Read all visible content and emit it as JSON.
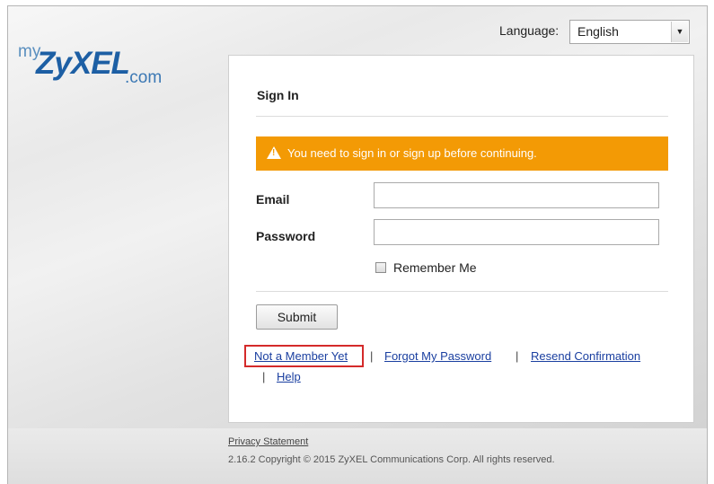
{
  "logo": {
    "my": "my",
    "brand": "ZyXEL",
    "suffix": ".com"
  },
  "language": {
    "label": "Language:",
    "selected": "English"
  },
  "signin": {
    "title": "Sign In",
    "alert": "You need to sign in or sign up before continuing.",
    "email_label": "Email",
    "password_label": "Password",
    "email_value": "",
    "password_value": "",
    "remember_label": "Remember Me",
    "submit_label": "Submit"
  },
  "links": {
    "not_member": "Not a Member Yet",
    "forgot": "Forgot My Password",
    "resend": "Resend Confirmation",
    "help": "Help",
    "separator": "|"
  },
  "footer": {
    "privacy": "Privacy Statement",
    "copyright": "2.16.2 Copyright © 2015 ZyXEL Communications Corp. All rights reserved."
  },
  "colors": {
    "alert": "#f39a05",
    "link": "#1a3fa0",
    "highlight": "#d42a2a",
    "brand": "#1d5fa4"
  }
}
